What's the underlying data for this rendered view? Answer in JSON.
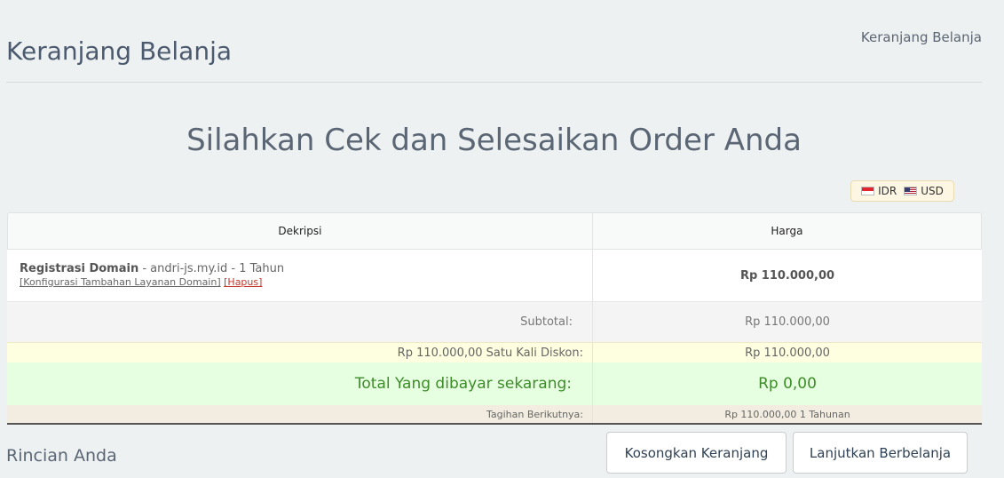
{
  "header": {
    "title": "Keranjang Belanja",
    "breadcrumb": "Keranjang Belanja"
  },
  "main": {
    "heading": "Silahkan Cek dan Selesaikan Order Anda"
  },
  "currency": {
    "options": [
      {
        "code": "IDR",
        "flag": "flag-indonesia-icon"
      },
      {
        "code": "USD",
        "flag": "flag-usa-icon"
      }
    ]
  },
  "cart": {
    "headers": {
      "description": "Dekripsi",
      "price": "Harga"
    },
    "item": {
      "name": "Registrasi Domain",
      "detail": " - andri-js.my.id - 1 Tahun",
      "config_link": "[Konfigurasi Tambahan Layanan Domain]",
      "remove_link": "[Hapus]",
      "price": "Rp 110.000,00"
    },
    "subtotal": {
      "label": "Subtotal:",
      "value": "Rp 110.000,00"
    },
    "discount": {
      "label": "Rp 110.000,00 Satu Kali Diskon:",
      "value": "Rp 110.000,00"
    },
    "total": {
      "label": "Total Yang dibayar sekarang:",
      "value": "Rp 0,00"
    },
    "recurring": {
      "label": "Tagihan Berikutnya:",
      "value": "Rp 110.000,00 1 Tahunan"
    }
  },
  "footer": {
    "details_title": "Rincian Anda",
    "empty_button": "Kosongkan Keranjang",
    "continue_button": "Lanjutkan Berbelanja"
  },
  "colors": {
    "total_text": "#3d8c29",
    "total_bg": "#e6ffe0",
    "discount_bg": "#fefee0",
    "remove_link": "#c0392b"
  }
}
